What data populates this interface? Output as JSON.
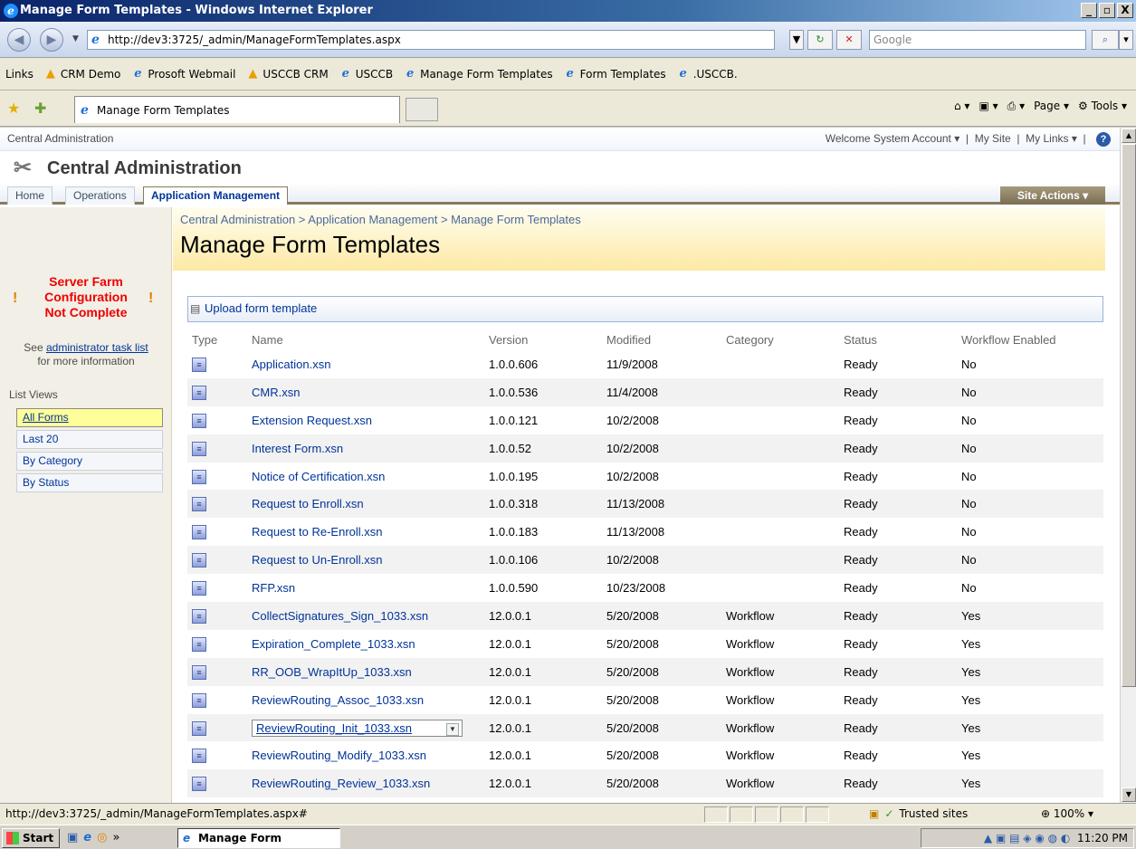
{
  "window": {
    "title": "Manage Form Templates - Windows Internet Explorer",
    "btn_min": "_",
    "btn_max": "▫",
    "btn_close": "X"
  },
  "address": {
    "url": "http://dev3:3725/_admin/ManageFormTemplates.aspx",
    "search_placeholder": "Google"
  },
  "links": {
    "label": "Links",
    "items": [
      "CRM Demo",
      "Prosoft Webmail",
      "USCCB CRM",
      "USCCB",
      "Manage Form Templates",
      "Form Templates",
      ".USCCB."
    ]
  },
  "tabs": {
    "active_tab": "Manage Form Templates",
    "page_cmd": "Page",
    "tools_cmd": "Tools"
  },
  "sp": {
    "global_left": "Central Administration",
    "welcome": "Welcome System Account",
    "my_site": "My Site",
    "my_links": "My Links",
    "site_title": "Central Administration",
    "nav_tabs": [
      "Home",
      "Operations",
      "Application Management"
    ],
    "site_actions": "Site Actions",
    "breadcrumb": "Central Administration > Application Management > Manage Form Templates",
    "page_title": "Manage Form Templates",
    "upload": "Upload form template"
  },
  "leftnav": {
    "warning_line1": "Server Farm",
    "warning_line2": "Configuration",
    "warning_line3": "Not Complete",
    "see": "See",
    "admin_link": "administrator task list",
    "more_info": "for more information",
    "list_views_title": "List Views",
    "views": [
      "All Forms",
      "Last 20",
      "By Category",
      "By Status"
    ]
  },
  "table": {
    "headers": [
      "Type",
      "Name",
      "Version",
      "Modified",
      "Category",
      "Status",
      "Workflow Enabled"
    ],
    "rows": [
      {
        "name": "Application.xsn",
        "version": "1.0.0.606",
        "modified": "11/9/2008",
        "category": "",
        "status": "Ready",
        "workflow": "No"
      },
      {
        "name": "CMR.xsn",
        "version": "1.0.0.536",
        "modified": "11/4/2008",
        "category": "",
        "status": "Ready",
        "workflow": "No"
      },
      {
        "name": "Extension Request.xsn",
        "version": "1.0.0.121",
        "modified": "10/2/2008",
        "category": "",
        "status": "Ready",
        "workflow": "No"
      },
      {
        "name": "Interest Form.xsn",
        "version": "1.0.0.52",
        "modified": "10/2/2008",
        "category": "",
        "status": "Ready",
        "workflow": "No"
      },
      {
        "name": "Notice of Certification.xsn",
        "version": "1.0.0.195",
        "modified": "10/2/2008",
        "category": "",
        "status": "Ready",
        "workflow": "No"
      },
      {
        "name": "Request to Enroll.xsn",
        "version": "1.0.0.318",
        "modified": "11/13/2008",
        "category": "",
        "status": "Ready",
        "workflow": "No"
      },
      {
        "name": "Request to Re-Enroll.xsn",
        "version": "1.0.0.183",
        "modified": "11/13/2008",
        "category": "",
        "status": "Ready",
        "workflow": "No"
      },
      {
        "name": "Request to Un-Enroll.xsn",
        "version": "1.0.0.106",
        "modified": "10/2/2008",
        "category": "",
        "status": "Ready",
        "workflow": "No"
      },
      {
        "name": "RFP.xsn",
        "version": "1.0.0.590",
        "modified": "10/23/2008",
        "category": "",
        "status": "Ready",
        "workflow": "No"
      },
      {
        "name": "CollectSignatures_Sign_1033.xsn",
        "version": "12.0.0.1",
        "modified": "5/20/2008",
        "category": "Workflow",
        "status": "Ready",
        "workflow": "Yes"
      },
      {
        "name": "Expiration_Complete_1033.xsn",
        "version": "12.0.0.1",
        "modified": "5/20/2008",
        "category": "Workflow",
        "status": "Ready",
        "workflow": "Yes"
      },
      {
        "name": "RR_OOB_WrapItUp_1033.xsn",
        "version": "12.0.0.1",
        "modified": "5/20/2008",
        "category": "Workflow",
        "status": "Ready",
        "workflow": "Yes"
      },
      {
        "name": "ReviewRouting_Assoc_1033.xsn",
        "version": "12.0.0.1",
        "modified": "5/20/2008",
        "category": "Workflow",
        "status": "Ready",
        "workflow": "Yes"
      },
      {
        "name": "ReviewRouting_Init_1033.xsn",
        "version": "12.0.0.1",
        "modified": "5/20/2008",
        "category": "Workflow",
        "status": "Ready",
        "workflow": "Yes"
      },
      {
        "name": "ReviewRouting_Modify_1033.xsn",
        "version": "12.0.0.1",
        "modified": "5/20/2008",
        "category": "Workflow",
        "status": "Ready",
        "workflow": "Yes"
      },
      {
        "name": "ReviewRouting_Review_1033.xsn",
        "version": "12.0.0.1",
        "modified": "5/20/2008",
        "category": "Workflow",
        "status": "Ready",
        "workflow": "Yes"
      }
    ]
  },
  "status": {
    "url": "http://dev3:3725/_admin/ManageFormTemplates.aspx#",
    "zone": "Trusted sites",
    "zoom": "100%"
  },
  "taskbar": {
    "start": "Start",
    "task": "Manage Form Templa...",
    "time": "11:20 PM"
  }
}
